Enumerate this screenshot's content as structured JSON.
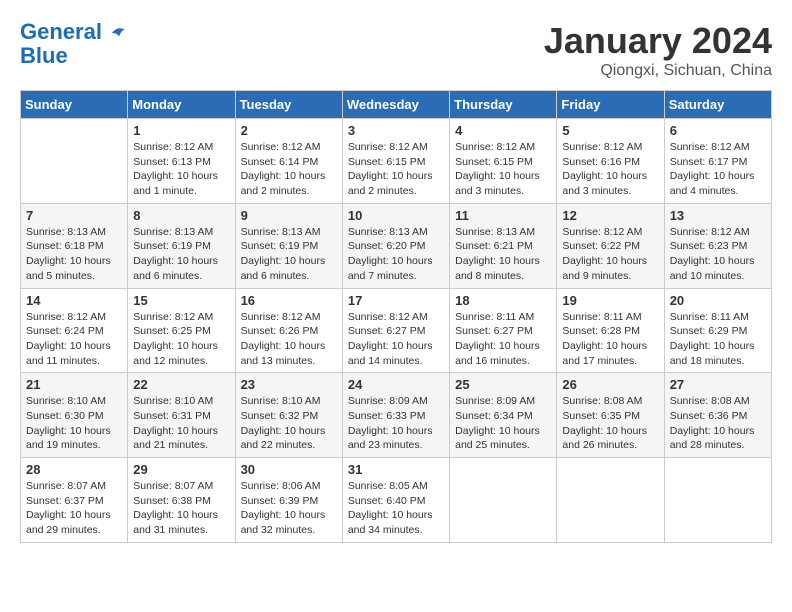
{
  "header": {
    "logo_line1": "General",
    "logo_line2": "Blue",
    "month": "January 2024",
    "location": "Qiongxi, Sichuan, China"
  },
  "weekdays": [
    "Sunday",
    "Monday",
    "Tuesday",
    "Wednesday",
    "Thursday",
    "Friday",
    "Saturday"
  ],
  "weeks": [
    [
      {
        "day": "",
        "sunrise": "",
        "sunset": "",
        "daylight": ""
      },
      {
        "day": "1",
        "sunrise": "Sunrise: 8:12 AM",
        "sunset": "Sunset: 6:13 PM",
        "daylight": "Daylight: 10 hours and 1 minute."
      },
      {
        "day": "2",
        "sunrise": "Sunrise: 8:12 AM",
        "sunset": "Sunset: 6:14 PM",
        "daylight": "Daylight: 10 hours and 2 minutes."
      },
      {
        "day": "3",
        "sunrise": "Sunrise: 8:12 AM",
        "sunset": "Sunset: 6:15 PM",
        "daylight": "Daylight: 10 hours and 2 minutes."
      },
      {
        "day": "4",
        "sunrise": "Sunrise: 8:12 AM",
        "sunset": "Sunset: 6:15 PM",
        "daylight": "Daylight: 10 hours and 3 minutes."
      },
      {
        "day": "5",
        "sunrise": "Sunrise: 8:12 AM",
        "sunset": "Sunset: 6:16 PM",
        "daylight": "Daylight: 10 hours and 3 minutes."
      },
      {
        "day": "6",
        "sunrise": "Sunrise: 8:12 AM",
        "sunset": "Sunset: 6:17 PM",
        "daylight": "Daylight: 10 hours and 4 minutes."
      }
    ],
    [
      {
        "day": "7",
        "sunrise": "Sunrise: 8:13 AM",
        "sunset": "Sunset: 6:18 PM",
        "daylight": "Daylight: 10 hours and 5 minutes."
      },
      {
        "day": "8",
        "sunrise": "Sunrise: 8:13 AM",
        "sunset": "Sunset: 6:19 PM",
        "daylight": "Daylight: 10 hours and 6 minutes."
      },
      {
        "day": "9",
        "sunrise": "Sunrise: 8:13 AM",
        "sunset": "Sunset: 6:19 PM",
        "daylight": "Daylight: 10 hours and 6 minutes."
      },
      {
        "day": "10",
        "sunrise": "Sunrise: 8:13 AM",
        "sunset": "Sunset: 6:20 PM",
        "daylight": "Daylight: 10 hours and 7 minutes."
      },
      {
        "day": "11",
        "sunrise": "Sunrise: 8:13 AM",
        "sunset": "Sunset: 6:21 PM",
        "daylight": "Daylight: 10 hours and 8 minutes."
      },
      {
        "day": "12",
        "sunrise": "Sunrise: 8:12 AM",
        "sunset": "Sunset: 6:22 PM",
        "daylight": "Daylight: 10 hours and 9 minutes."
      },
      {
        "day": "13",
        "sunrise": "Sunrise: 8:12 AM",
        "sunset": "Sunset: 6:23 PM",
        "daylight": "Daylight: 10 hours and 10 minutes."
      }
    ],
    [
      {
        "day": "14",
        "sunrise": "Sunrise: 8:12 AM",
        "sunset": "Sunset: 6:24 PM",
        "daylight": "Daylight: 10 hours and 11 minutes."
      },
      {
        "day": "15",
        "sunrise": "Sunrise: 8:12 AM",
        "sunset": "Sunset: 6:25 PM",
        "daylight": "Daylight: 10 hours and 12 minutes."
      },
      {
        "day": "16",
        "sunrise": "Sunrise: 8:12 AM",
        "sunset": "Sunset: 6:26 PM",
        "daylight": "Daylight: 10 hours and 13 minutes."
      },
      {
        "day": "17",
        "sunrise": "Sunrise: 8:12 AM",
        "sunset": "Sunset: 6:27 PM",
        "daylight": "Daylight: 10 hours and 14 minutes."
      },
      {
        "day": "18",
        "sunrise": "Sunrise: 8:11 AM",
        "sunset": "Sunset: 6:27 PM",
        "daylight": "Daylight: 10 hours and 16 minutes."
      },
      {
        "day": "19",
        "sunrise": "Sunrise: 8:11 AM",
        "sunset": "Sunset: 6:28 PM",
        "daylight": "Daylight: 10 hours and 17 minutes."
      },
      {
        "day": "20",
        "sunrise": "Sunrise: 8:11 AM",
        "sunset": "Sunset: 6:29 PM",
        "daylight": "Daylight: 10 hours and 18 minutes."
      }
    ],
    [
      {
        "day": "21",
        "sunrise": "Sunrise: 8:10 AM",
        "sunset": "Sunset: 6:30 PM",
        "daylight": "Daylight: 10 hours and 19 minutes."
      },
      {
        "day": "22",
        "sunrise": "Sunrise: 8:10 AM",
        "sunset": "Sunset: 6:31 PM",
        "daylight": "Daylight: 10 hours and 21 minutes."
      },
      {
        "day": "23",
        "sunrise": "Sunrise: 8:10 AM",
        "sunset": "Sunset: 6:32 PM",
        "daylight": "Daylight: 10 hours and 22 minutes."
      },
      {
        "day": "24",
        "sunrise": "Sunrise: 8:09 AM",
        "sunset": "Sunset: 6:33 PM",
        "daylight": "Daylight: 10 hours and 23 minutes."
      },
      {
        "day": "25",
        "sunrise": "Sunrise: 8:09 AM",
        "sunset": "Sunset: 6:34 PM",
        "daylight": "Daylight: 10 hours and 25 minutes."
      },
      {
        "day": "26",
        "sunrise": "Sunrise: 8:08 AM",
        "sunset": "Sunset: 6:35 PM",
        "daylight": "Daylight: 10 hours and 26 minutes."
      },
      {
        "day": "27",
        "sunrise": "Sunrise: 8:08 AM",
        "sunset": "Sunset: 6:36 PM",
        "daylight": "Daylight: 10 hours and 28 minutes."
      }
    ],
    [
      {
        "day": "28",
        "sunrise": "Sunrise: 8:07 AM",
        "sunset": "Sunset: 6:37 PM",
        "daylight": "Daylight: 10 hours and 29 minutes."
      },
      {
        "day": "29",
        "sunrise": "Sunrise: 8:07 AM",
        "sunset": "Sunset: 6:38 PM",
        "daylight": "Daylight: 10 hours and 31 minutes."
      },
      {
        "day": "30",
        "sunrise": "Sunrise: 8:06 AM",
        "sunset": "Sunset: 6:39 PM",
        "daylight": "Daylight: 10 hours and 32 minutes."
      },
      {
        "day": "31",
        "sunrise": "Sunrise: 8:05 AM",
        "sunset": "Sunset: 6:40 PM",
        "daylight": "Daylight: 10 hours and 34 minutes."
      },
      {
        "day": "",
        "sunrise": "",
        "sunset": "",
        "daylight": ""
      },
      {
        "day": "",
        "sunrise": "",
        "sunset": "",
        "daylight": ""
      },
      {
        "day": "",
        "sunrise": "",
        "sunset": "",
        "daylight": ""
      }
    ]
  ]
}
